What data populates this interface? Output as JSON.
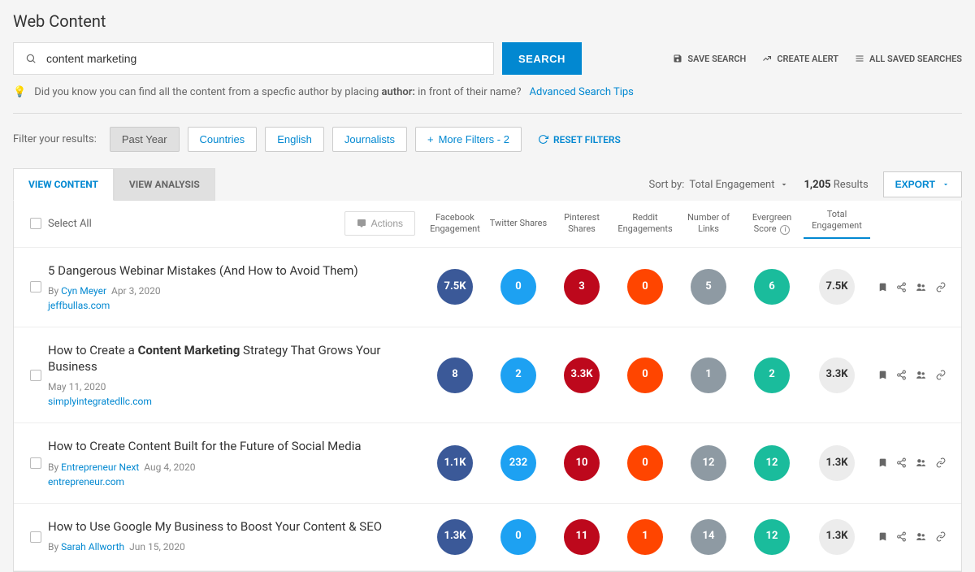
{
  "page_title": "Web Content",
  "search": {
    "value": "content marketing",
    "button": "SEARCH"
  },
  "top_actions": {
    "save_search": "SAVE SEARCH",
    "create_alert": "CREATE ALERT",
    "all_saved": "ALL SAVED SEARCHES"
  },
  "tip": {
    "text_pre": "Did you know you can find all the content from a specfic author by placing ",
    "bold": "author:",
    "text_post": " in front of their name?",
    "link": "Advanced Search Tips"
  },
  "filter": {
    "label": "Filter your results:",
    "past_year": "Past Year",
    "countries": "Countries",
    "english": "English",
    "journalists": "Journalists",
    "more": "More Filters - 2",
    "reset": "RESET FILTERS"
  },
  "tabs": {
    "view_content": "VIEW CONTENT",
    "view_analysis": "VIEW ANALYSIS"
  },
  "sort": {
    "label": "Sort by:",
    "value": "Total Engagement"
  },
  "results_count": "1,205",
  "results_label": "Results",
  "export": "EXPORT",
  "header": {
    "select_all": "Select All",
    "actions": "Actions",
    "cols": [
      "Facebook Engagement",
      "Twitter Shares",
      "Pinterest Shares",
      "Reddit Engagements",
      "Number of Links",
      "Evergreen Score",
      "Total Engagement"
    ]
  },
  "by_label": "By",
  "rows": [
    {
      "title": "5 Dangerous Webinar Mistakes (And How to Avoid Them)",
      "title_highlight": "",
      "author": "Cyn Meyer",
      "date": "Apr 3, 2020",
      "domain": "jeffbullas.com",
      "metrics": {
        "fb": "7.5K",
        "tw": "0",
        "pin": "3",
        "rd": "0",
        "links": "5",
        "eg": "6",
        "total": "7.5K"
      }
    },
    {
      "title_pre": "How to Create a ",
      "title_highlight": "Content Marketing",
      "title_post": " Strategy That Grows Your Business",
      "author": "",
      "date": "May 11, 2020",
      "domain": "simplyintegratedllc.com",
      "metrics": {
        "fb": "8",
        "tw": "2",
        "pin": "3.3K",
        "rd": "0",
        "links": "1",
        "eg": "2",
        "total": "3.3K"
      }
    },
    {
      "title": "How to Create Content Built for the Future of Social Media",
      "title_highlight": "",
      "author": "Entrepreneur Next",
      "date": "Aug 4, 2020",
      "domain": "entrepreneur.com",
      "metrics": {
        "fb": "1.1K",
        "tw": "232",
        "pin": "10",
        "rd": "0",
        "links": "12",
        "eg": "12",
        "total": "1.3K"
      }
    },
    {
      "title": "How to Use Google My Business to Boost Your Content & SEO",
      "title_highlight": "",
      "author": "Sarah Allworth",
      "date": "Jun 15, 2020",
      "domain": "",
      "metrics": {
        "fb": "1.3K",
        "tw": "0",
        "pin": "11",
        "rd": "1",
        "links": "14",
        "eg": "12",
        "total": "1.3K"
      }
    }
  ]
}
